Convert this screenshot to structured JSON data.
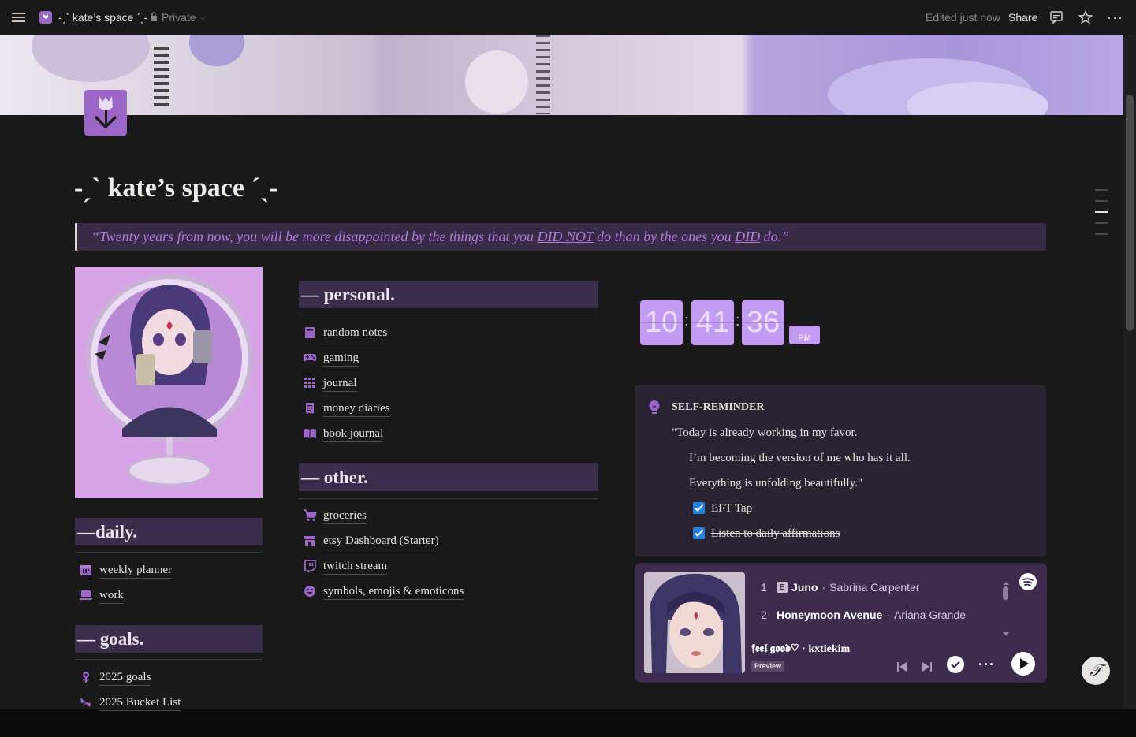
{
  "topbar": {
    "page_title": "-ˏˋ kate’s space ˊˎ-",
    "privacy": "Private",
    "edited": "Edited just now",
    "share": "Share"
  },
  "page": {
    "title": "-ˏˋ kate’s space ˊˎ-",
    "quote": {
      "part1": "“Twenty years from now, you will be more disappointed by the things that you ",
      "em1": "DID NOT",
      "part2": " do than by the ones you ",
      "em2": "DID",
      "part3": " do.”"
    }
  },
  "sections": {
    "daily": {
      "heading": "—daily.",
      "items": [
        {
          "label": "weekly planner",
          "icon": "calendar-icon"
        },
        {
          "label": "work",
          "icon": "laptop-icon"
        }
      ]
    },
    "goals": {
      "heading": "— goals.",
      "items": [
        {
          "label": "2025 goals",
          "icon": "flower-icon"
        },
        {
          "label": "2025 Bucket List",
          "icon": "butterfly-icon"
        }
      ]
    },
    "personal": {
      "heading": "— personal.",
      "items": [
        {
          "label": "random notes",
          "icon": "notebook-icon"
        },
        {
          "label": "gaming",
          "icon": "gamepad-icon"
        },
        {
          "label": "journal",
          "icon": "grid-icon"
        },
        {
          "label": "money diaries",
          "icon": "receipt-icon"
        },
        {
          "label": "book journal",
          "icon": "book-icon"
        }
      ]
    },
    "other": {
      "heading": "— other.",
      "items": [
        {
          "label": "groceries",
          "icon": "cart-icon"
        },
        {
          "label": "etsy Dashboard (Starter)",
          "icon": "store-icon"
        },
        {
          "label": "twitch stream",
          "icon": "twitch-icon"
        },
        {
          "label": "symbols, emojis & emoticons",
          "icon": "smiley-icon"
        }
      ]
    }
  },
  "clock": {
    "hours": "10",
    "minutes": "41",
    "seconds": "36",
    "ampm": "PM"
  },
  "callout": {
    "heading": "SELF-REMINDER",
    "lines": [
      "\"Today is already working in my favor.",
      "I’m becoming the version of me who has it all.",
      "Everything is unfolding beautifully.\""
    ],
    "todos": [
      {
        "label": "EFT Tap",
        "checked": true
      },
      {
        "label": "Listen to daily affirmations",
        "checked": true
      }
    ]
  },
  "spotify": {
    "tracks": [
      {
        "num": "1",
        "explicit": "E",
        "title": "Juno",
        "artist": "Sabrina Carpenter"
      },
      {
        "num": "2",
        "title": "Honeymoon Avenue",
        "artist": "Ariana Grande"
      }
    ],
    "playlist": "𝖋𝖊𝖊𝖑 𝖌𝖔𝖔𝖉♡ · kxtiekim",
    "badge": "Preview"
  },
  "colors": {
    "accent": "#9c66c9",
    "header_bg": "#3b2d4c",
    "quote_text": "#b47ae0",
    "clock": "#c49bf2"
  }
}
